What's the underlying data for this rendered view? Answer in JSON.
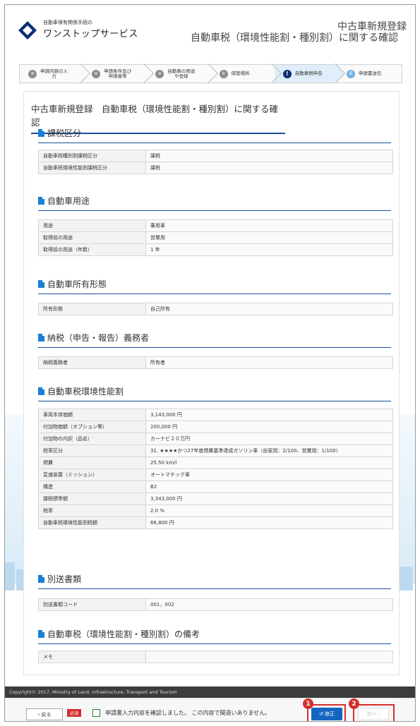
{
  "header": {
    "logo_sub": "自動車保有関係手続の",
    "logo_main": "ワンストップサービス",
    "title_line1": "中古車新規登録",
    "title_line2": "自動車税（環境性能割・種別割）に関する確認"
  },
  "steps": [
    {
      "icon": "※",
      "label": "申請内容の入\n力"
    },
    {
      "icon": "※",
      "label": "申請条件及び\n申請者等"
    },
    {
      "icon": "※",
      "label": "自動車の用途\nや登録"
    },
    {
      "icon": "※",
      "label": "保管場所"
    },
    {
      "icon": "!",
      "label": "自動車税申告"
    },
    {
      "icon": "未",
      "label": "申請書送信"
    }
  ],
  "page_heading": "中古車新規登録　自動車税（環境性能割・種別割）に関する確認",
  "sections": [
    {
      "title": "課税区分",
      "rows": [
        {
          "k": "自動車税種別割課税区分",
          "v": "課税"
        },
        {
          "k": "自動車税環境性能割課税区分",
          "v": "課税"
        }
      ]
    },
    {
      "title": "自動車用途",
      "rows": [
        {
          "k": "用途",
          "v": "乗用車"
        },
        {
          "k": "取得前の用途",
          "v": "営業用"
        },
        {
          "k": "取得前の用途（年数）",
          "v": "1 年"
        }
      ]
    },
    {
      "title": "自動車所有形態",
      "rows": [
        {
          "k": "所有形態",
          "v": "自己所有"
        }
      ]
    },
    {
      "title": "納税（申告・報告）義務者",
      "rows": [
        {
          "k": "納税義務者",
          "v": "所有者"
        }
      ]
    },
    {
      "title": "自動車税環境性能割",
      "rows": [
        {
          "k": "車両本体価額",
          "v": "3,143,000 円"
        },
        {
          "k": "付加物価額（オプション等）",
          "v": "200,000 円"
        },
        {
          "k": "付加物の内訳（品名）",
          "v": "カーナビ２０万円"
        },
        {
          "k": "税率区分",
          "v": "31. ★★★★かつ27年度燃費基準達成ガソリン車（自家用：2/100、営業用：1/100）"
        },
        {
          "k": "燃費",
          "v": "25.50 km/l"
        },
        {
          "k": "変速装置（ミッション）",
          "v": "オートマチック車"
        },
        {
          "k": "構造",
          "v": "B2"
        },
        {
          "k": "課税標準額",
          "v": "3,343,000 円"
        },
        {
          "k": "税率",
          "v": "2.0 %"
        },
        {
          "k": "自動車税環境性能割税額",
          "v": "66,800 円"
        }
      ]
    },
    {
      "title": "別送書類",
      "rows": [
        {
          "k": "別送書類コード",
          "v": "001，002"
        }
      ]
    },
    {
      "title": "自動車税（環境性能割・種別割）の備考",
      "rows": [
        {
          "k": "メモ",
          "v": ""
        }
      ]
    }
  ],
  "footer": {
    "copyright": "Copyright© 2017, Ministry of Land, Infrastructure, Transport and Tourism",
    "back_label": "‹  戻る",
    "required_label": "必須",
    "confirm_text": "申請書入力内容を確認しました。 この内容で間違いありません。",
    "edit_label": "↺  修正",
    "next_label": "次へ  ›",
    "badge1": "1",
    "badge2": "2"
  },
  "colors": {
    "accent": "#1a4d9c",
    "primary_button": "#1565c0",
    "highlight": "#d32f2f"
  }
}
